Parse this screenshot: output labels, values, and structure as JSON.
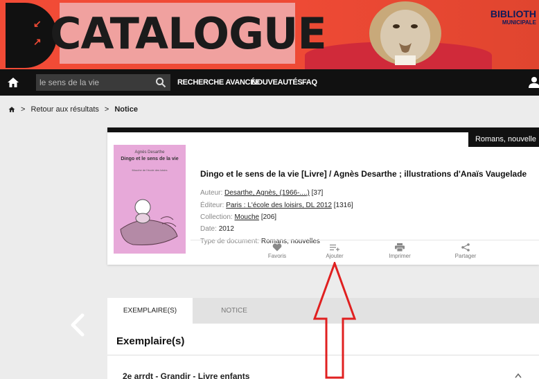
{
  "header": {
    "catalogue_title": "CATALOGUE",
    "biblio_line1": "BIBLIOTH",
    "biblio_line2": "MUNICIPALE"
  },
  "nav": {
    "search_value": "le sens de la vie",
    "advanced_search": "RECHERCHE AVANCÉE",
    "news": "NOUVEAUTÉS",
    "faq": "FAQ"
  },
  "breadcrumb": {
    "sep": ">",
    "back": "Retour aux résultats",
    "current": "Notice"
  },
  "notice": {
    "doc_type_tag": "Romans, nouvelle",
    "cover_author": "Agnès Desarthe",
    "cover_title": "Dingo et le sens de la vie",
    "cover_subtitle": "Mouche de l'école des loisirs",
    "title": "Dingo et le sens de la vie [Livre] / Agnès Desarthe ; illustrations d'Anaïs Vaugelade",
    "author_label": "Auteur:",
    "author_value": "Desarthe, Agnès, (1966-....)",
    "author_count": "[37]",
    "publisher_label": "Éditeur:",
    "publisher_value": "Paris : L'école des loisirs, DL 2012",
    "publisher_count": "[1316]",
    "collection_label": "Collection:",
    "collection_value": "Mouche",
    "collection_count": "[206]",
    "date_label": "Date:",
    "date_value": "2012",
    "doctype_label": "Type de document:",
    "doctype_value": "Romans, nouvelles"
  },
  "actions": {
    "favoris": "Favoris",
    "ajouter": "Ajouter",
    "imprimer": "Imprimer",
    "partager": "Partager"
  },
  "tabs": {
    "exemplaires": "EXEMPLAIRE(S)",
    "notice": "NOTICE"
  },
  "exemplaires": {
    "title": "Exemplaire(s)",
    "first_row": "2e arrdt - Grandir - Livre enfants"
  },
  "colors": {
    "banner": "#ee4a35",
    "nav": "#111111",
    "annotation": "#e02020"
  }
}
